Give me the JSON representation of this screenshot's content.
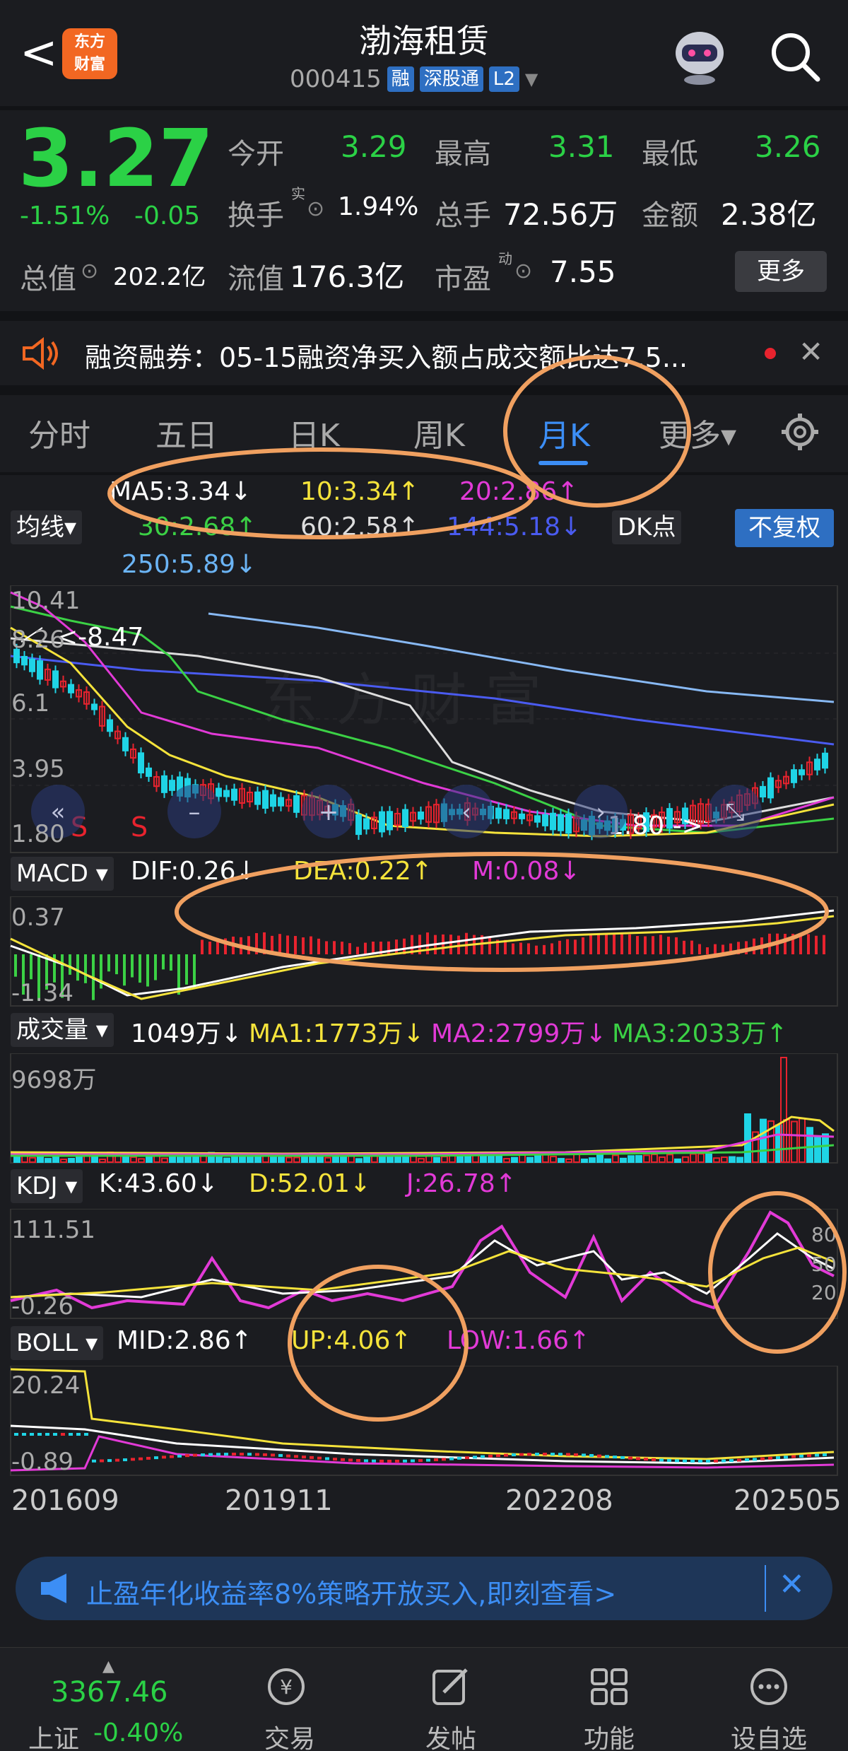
{
  "header": {
    "back": "<",
    "logo": "东方\n财富",
    "title": "渤海租赁",
    "code": "000415",
    "tags": [
      "融",
      "深股通",
      "L2"
    ]
  },
  "quote": {
    "price": "3.27",
    "pct": "-1.51%",
    "chg": "-0.05",
    "open_label": "今开",
    "open": "3.29",
    "high_label": "最高",
    "high": "3.31",
    "low_label": "最低",
    "low": "3.26",
    "turnover_label": "换手",
    "turnover_sup": "实",
    "turnover": "1.94%",
    "vol_label": "总手",
    "vol": "72.56万",
    "amount_label": "金额",
    "amount": "2.38亿",
    "mktcap_label": "总值",
    "mktcap": "202.2亿",
    "float_label": "流值",
    "float": "176.3亿",
    "pe_label": "市盈",
    "pe_sup": "动",
    "pe": "7.55",
    "more": "更多"
  },
  "notice": {
    "text": "融资融券：05-15融资净买入额占成交额比达7.5...",
    "close": "✕"
  },
  "tabs": [
    "分时",
    "五日",
    "日K",
    "周K",
    "月K",
    "更多▾"
  ],
  "ma": {
    "ma5": "MA5:3.34↓",
    "ma10": "10:3.34↑",
    "ma20": "20:2.86↑",
    "ma30": "30:2.68↑",
    "ma60": "60:2.58↑",
    "ma144": "144:5.18↓",
    "ma250": "250:5.89↓",
    "selector": "均线▾",
    "dk": "DK点",
    "fq": "不复权"
  },
  "kchart": {
    "y": [
      "10.41",
      "8.26",
      "6.1",
      "3.95",
      "1.80"
    ],
    "high_mark": "<-8.47",
    "low_mark": "1.80 ->",
    "s1": "S",
    "s2": "S"
  },
  "macd": {
    "name": "MACD ▾",
    "dif": "DIF:0.26↓",
    "dea": "DEA:0.22↑",
    "m": "M:0.08↓",
    "y": [
      "0.37",
      "-1.34"
    ]
  },
  "vol": {
    "name": "成交量 ▾",
    "v": "1049万↓",
    "ma1": "MA1:1773万↓",
    "ma2": "MA2:2799万↓",
    "ma3": "MA3:2033万↑",
    "y": [
      "9698万"
    ]
  },
  "kdj": {
    "name": "KDJ ▾",
    "k": "K:43.60↓",
    "d": "D:52.01↓",
    "j": "J:26.78↑",
    "y": [
      "111.51",
      "-0.26"
    ],
    "r": [
      "80",
      "50",
      "20"
    ]
  },
  "boll": {
    "name": "BOLL ▾",
    "mid": "MID:2.86↑",
    "up": "UP:4.06↑",
    "low": "LOW:1.66↑",
    "y": [
      "20.24",
      "-0.89"
    ]
  },
  "xaxis": [
    "201609",
    "201911",
    "202208",
    "202505"
  ],
  "ad": {
    "text": "止盈年化收益率8%策略开放买入,即刻查看>",
    "close": "✕"
  },
  "nav": {
    "index_value": "3367.46",
    "index_name": "上证",
    "index_pct": "-0.40%",
    "items": [
      "交易",
      "发帖",
      "功能",
      "设自选"
    ]
  },
  "colors": {
    "up": "#e8232e",
    "down": "#2bd146",
    "accent": "#3c8ef5",
    "annotation": "#f0a060"
  }
}
